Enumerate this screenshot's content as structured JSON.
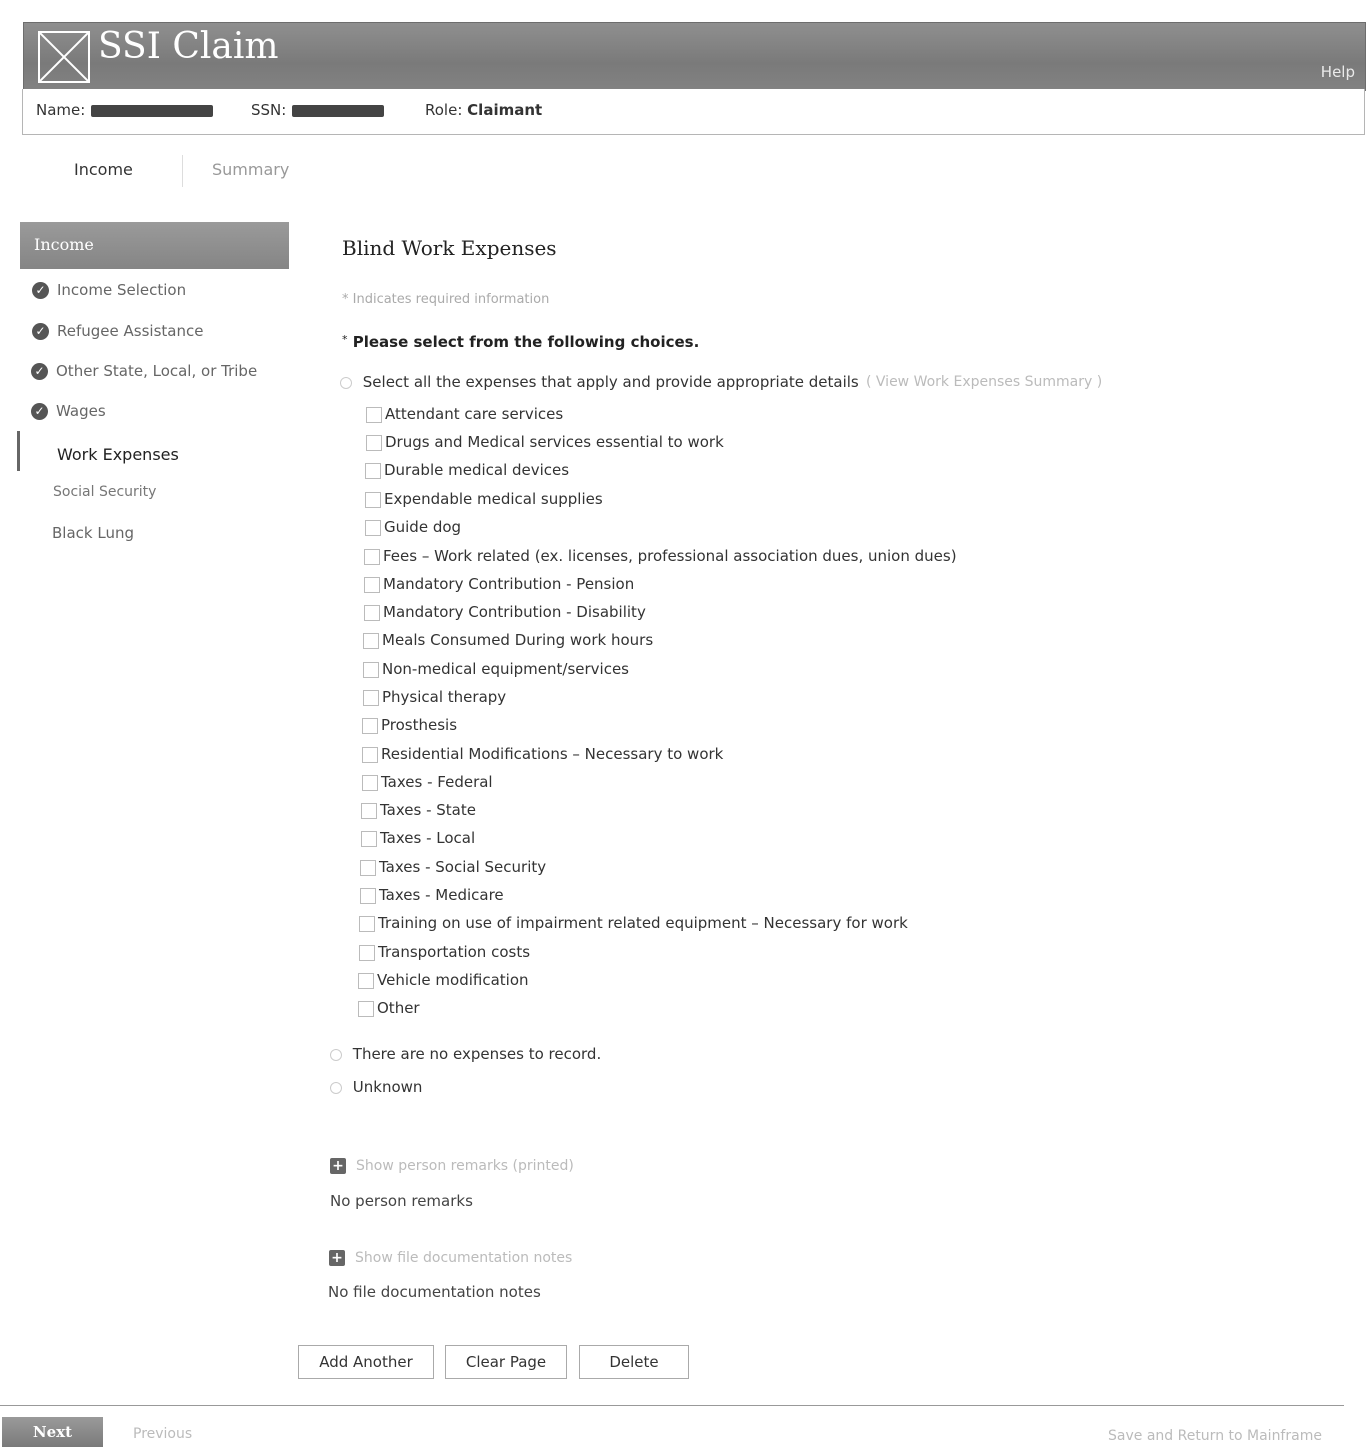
{
  "header": {
    "title": "SSI Claim",
    "help": "Help",
    "name_label": "Name:",
    "ssn_label": "SSN:",
    "role_label": "Role:",
    "role_value": "Claimant"
  },
  "tabs": [
    {
      "label": "Income"
    },
    {
      "label": "Summary"
    }
  ],
  "sidebar": {
    "heading": "Income",
    "items": [
      {
        "label": "Income Selection",
        "status": "complete"
      },
      {
        "label": "Refugee Assistance",
        "status": "complete"
      },
      {
        "label": "Other State, Local, or Tribe",
        "status": "complete"
      },
      {
        "label": "Wages",
        "status": "complete"
      },
      {
        "label": "Work Expenses",
        "status": "active"
      },
      {
        "label": "Social Security",
        "status": "pending"
      },
      {
        "label": "Black Lung",
        "status": "pending"
      }
    ]
  },
  "main": {
    "title": "Blind Work Expenses",
    "required_note": "* Indicates required information",
    "prompt": "Please select from the following choices.",
    "option_select": "Select all the expenses that apply and provide appropriate details",
    "view_summary": "( View Work Expenses Summary )",
    "expenses": [
      "Attendant care services",
      "Drugs and Medical services essential to work",
      "Durable medical devices",
      "Expendable medical supplies",
      "Guide dog",
      "Fees – Work related (ex. licenses, professional association dues, union dues)",
      "Mandatory Contribution - Pension",
      "Mandatory Contribution - Disability",
      "Meals Consumed During work hours",
      "Non-medical equipment/services",
      "Physical therapy",
      "Prosthesis",
      "Residential Modifications – Necessary to work",
      "Taxes - Federal",
      "Taxes - State",
      "Taxes - Local",
      "Taxes - Social Security",
      "Taxes - Medicare",
      "Training on use of impairment related equipment – Necessary for work",
      "Transportation costs",
      "Vehicle modification",
      "Other"
    ],
    "option_none": "There are no expenses to record.",
    "option_unknown": "Unknown",
    "person_remarks_link": "Show person remarks (printed)",
    "person_remarks_text": "No person remarks",
    "file_notes_link": "Show file documentation notes",
    "file_notes_text": "No file documentation notes",
    "buttons": {
      "add_another": "Add Another",
      "clear_page": "Clear Page",
      "delete": "Delete"
    }
  },
  "footer": {
    "next": "Next",
    "previous": "Previous",
    "save_return": "Save and Return to Mainframe"
  }
}
